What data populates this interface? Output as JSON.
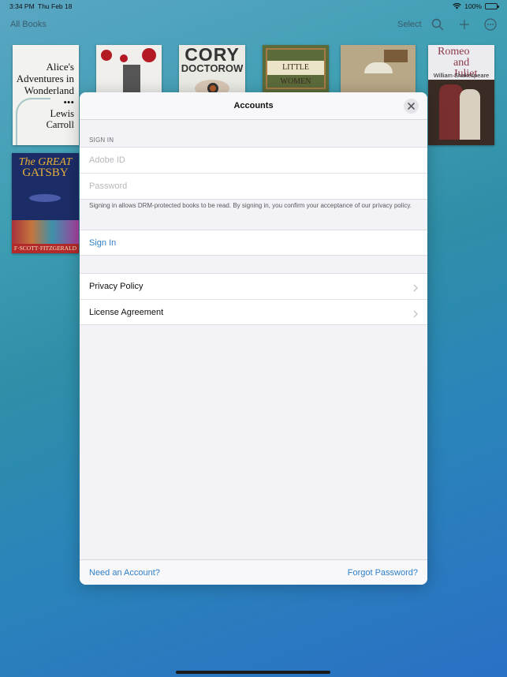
{
  "status_bar": {
    "time": "3:34 PM",
    "date": "Thu Feb 18",
    "battery": "100%"
  },
  "nav": {
    "title": "All Books",
    "select_label": "Select",
    "icons": [
      "search-icon",
      "plus-icon",
      "more-icon"
    ]
  },
  "books": [
    {
      "title_line1": "Alice's",
      "title_line2": "Adventures in",
      "title_line3": "Wonderland",
      "dots": "•••",
      "author_line1": "Lewis",
      "author_line2": "Carroll"
    },
    {
      "cover": "red-splatter-castle"
    },
    {
      "title_line1": "CORY",
      "title_line2": "DOCTOROW"
    },
    {
      "title": "LITTLE WOMEN"
    },
    {
      "cover": "parasol-painting"
    },
    {
      "title_line1": "Romeo",
      "title_line2": "and Juliet",
      "author": "William Shakespeare"
    },
    {
      "title_line1": "The GREAT",
      "title_line2": "GATSBY",
      "author": "F·SCOTT·FITZGERALD"
    }
  ],
  "modal": {
    "title": "Accounts",
    "section_label": "SIGN IN",
    "adobe_id_placeholder": "Adobe ID",
    "password_placeholder": "Password",
    "footnote": "Signing in allows DRM-protected books to be read. By signing in, you confirm your acceptance of our privacy policy.",
    "sign_in_label": "Sign In",
    "list_items": [
      {
        "label": "Privacy Policy"
      },
      {
        "label": "License Agreement"
      }
    ],
    "footer_left": "Need an Account?",
    "footer_right": "Forgot Password?"
  },
  "colors": {
    "accent": "#2f7fc6",
    "modal_bg": "#f2f2f7"
  }
}
